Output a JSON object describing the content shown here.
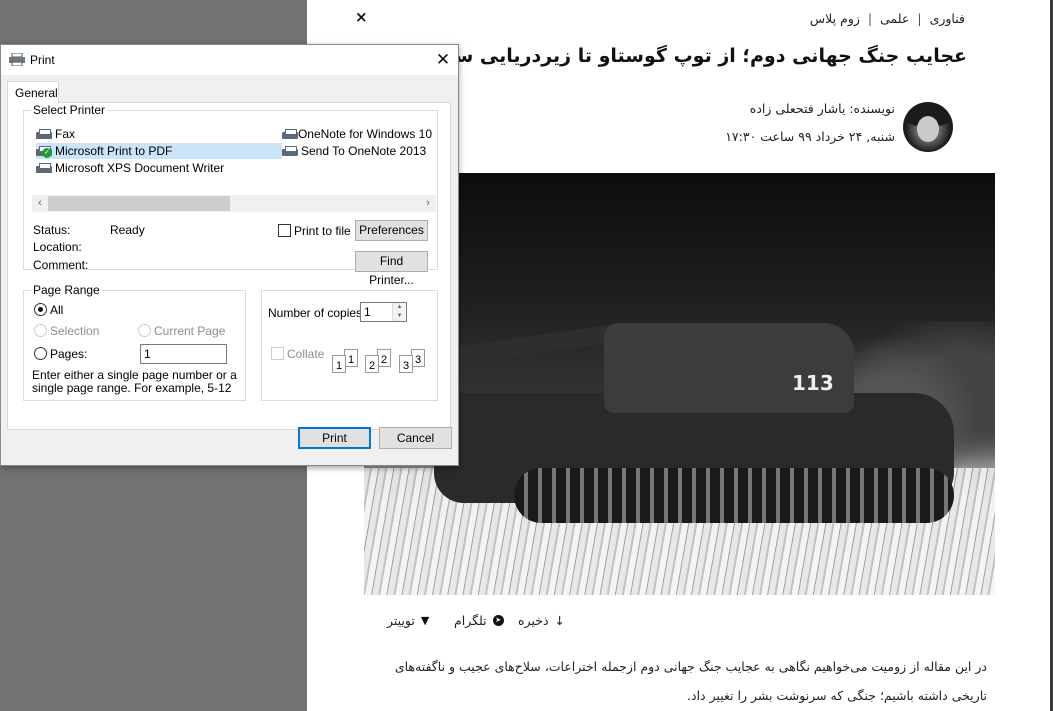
{
  "web_page": {
    "close_glyph": "×",
    "breadcrumb": [
      "فناوری",
      "علمی",
      "زوم پلاس"
    ],
    "breadcrumb_separator": "|",
    "title": "عجایب جنگ جهانی دوم؛ از توپ گوستاو تا زیردریایی سورکوف",
    "author": "نویسنده: یاشار فتحعلی زاده",
    "date": "شنبه, ۲۴ خرداد ۹۹ ساعت ۱۷:۳۰",
    "hero_image_number": "113",
    "share": {
      "save_label": "ذخیره",
      "save_icon": "↓",
      "telegram_label": "تلگرام",
      "telegram_icon": "➤",
      "twitter_label": "توییتر",
      "twitter_icon": "🐦"
    },
    "body_text": "در این مقاله از زومیت می‌خواهیم نگاهی به عجایب جنگ جهانی دوم ازجمله اختراعات، سلاح‌های عجیب و ناگفته‌های تاریخی داشته باشیم؛ جنگی که سرنوشت بشر را تغییر داد."
  },
  "print_dialog": {
    "title": "Print",
    "close_glyph": "✕",
    "tabs": [
      {
        "label": "General"
      }
    ],
    "select_printer": {
      "legend": "Select Printer",
      "printers": [
        {
          "name": "Fax",
          "selected": false,
          "default": false
        },
        {
          "name": "Microsoft Print to PDF",
          "selected": true,
          "default": true
        },
        {
          "name": "Microsoft XPS Document Writer",
          "selected": false,
          "default": false
        },
        {
          "name": "OneNote for Windows 10",
          "selected": false,
          "default": false
        },
        {
          "name": "Send To OneNote 2013",
          "selected": false,
          "default": false
        }
      ],
      "scroll_left": "‹",
      "scroll_right": "›",
      "status_label": "Status:",
      "status_value": "Ready",
      "location_label": "Location:",
      "location_value": "",
      "comment_label": "Comment:",
      "comment_value": "",
      "print_to_file_label": "Print to file",
      "print_to_file_checked": false,
      "preferences_button": "Preferences",
      "find_printer_button": "Find Printer..."
    },
    "page_range": {
      "legend": "Page Range",
      "all_label": "All",
      "selection_label": "Selection",
      "current_page_label": "Current Page",
      "pages_label": "Pages:",
      "pages_value": "1",
      "selected_option": "All",
      "hint": "Enter either a single page number or a single page range.  For example, 5-12"
    },
    "copies": {
      "label": "Number of copies:",
      "value": "1",
      "collate_label": "Collate",
      "collate_checked": false,
      "collate_pages": [
        "1",
        "1",
        "2",
        "2",
        "3",
        "3"
      ]
    },
    "buttons": {
      "print": "Print",
      "cancel": "Cancel"
    }
  }
}
